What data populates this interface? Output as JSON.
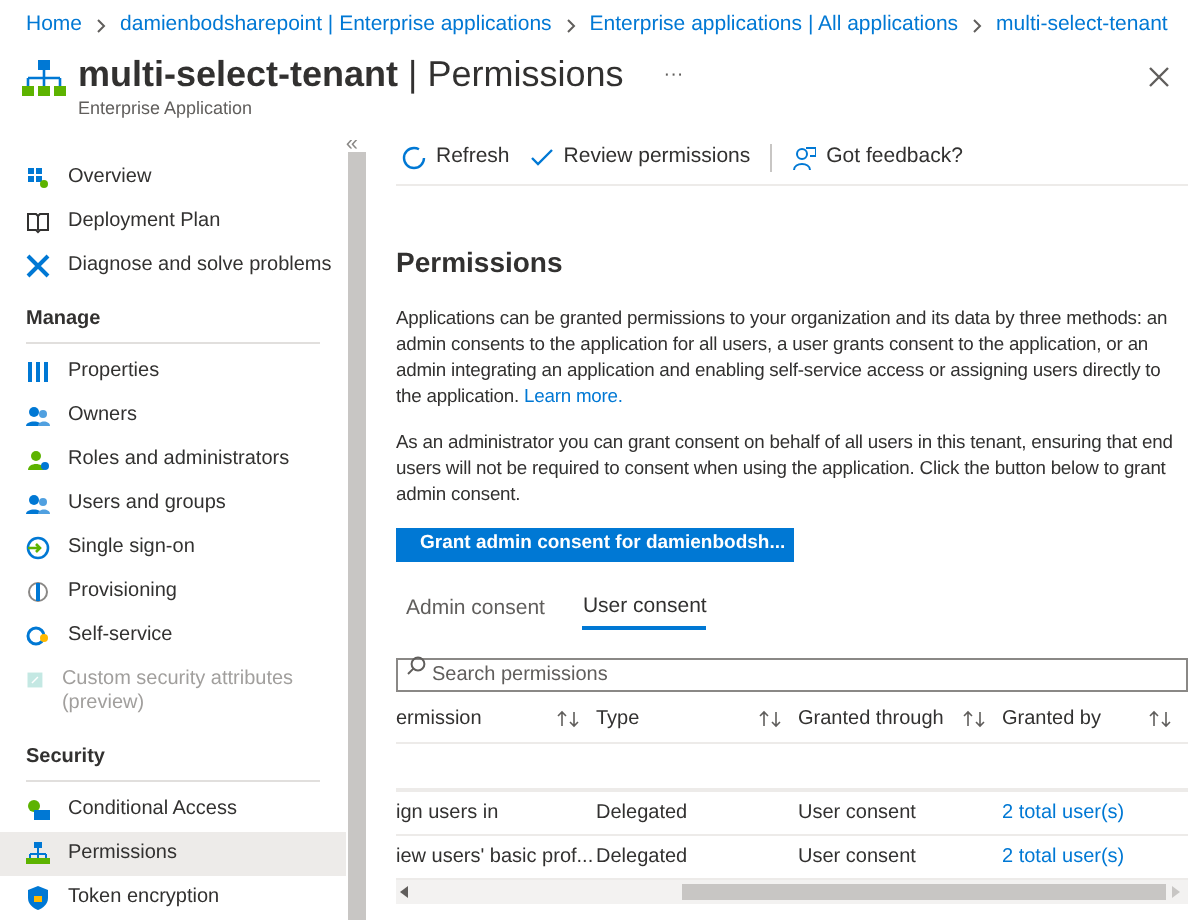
{
  "breadcrumb": [
    "Home",
    "damienbodsharepoint | Enterprise applications",
    "Enterprise applications | All applications",
    "multi-select-tenant"
  ],
  "header": {
    "title": "multi-select-tenant",
    "separator": "|",
    "page": "Permissions",
    "subtitle": "Enterprise Application",
    "more": "···"
  },
  "sidebar": {
    "collapse": "«",
    "sections": [
      {
        "items": [
          {
            "label": "Overview",
            "selected": false,
            "disabled": false
          },
          {
            "label": "Deployment Plan",
            "selected": false,
            "disabled": false
          },
          {
            "label": "Diagnose and solve problems",
            "selected": false,
            "disabled": false
          }
        ]
      },
      {
        "heading": "Manage",
        "items": [
          {
            "label": "Properties",
            "selected": false,
            "disabled": false
          },
          {
            "label": "Owners",
            "selected": false,
            "disabled": false
          },
          {
            "label": "Roles and administrators",
            "selected": false,
            "disabled": false
          },
          {
            "label": "Users and groups",
            "selected": false,
            "disabled": false
          },
          {
            "label": "Single sign-on",
            "selected": false,
            "disabled": false
          },
          {
            "label": "Provisioning",
            "selected": false,
            "disabled": false
          },
          {
            "label": "Self-service",
            "selected": false,
            "disabled": false
          },
          {
            "label": "Custom security attributes (preview)",
            "selected": false,
            "disabled": true
          }
        ]
      },
      {
        "heading": "Security",
        "items": [
          {
            "label": "Conditional Access",
            "selected": false,
            "disabled": false
          },
          {
            "label": "Permissions",
            "selected": true,
            "disabled": false
          },
          {
            "label": "Token encryption",
            "selected": false,
            "disabled": false
          }
        ]
      }
    ]
  },
  "toolbar": [
    "Refresh",
    "Review permissions",
    "Got feedback?"
  ],
  "content": {
    "heading": "Permissions",
    "intro": "Applications can be granted permissions to your organization and its data by three methods: an admin consents to the application for all users, a user grants consent to the application, or an admin integrating an application and enabling self-service access or assigning users directly to the application.",
    "learn_more": "Learn more.",
    "note": "As an administrator you can grant consent on behalf of all users in this tenant, ensuring that end users will not be required to consent when using the application. Click the button below to grant admin consent.",
    "grant_button": "Grant admin consent for damienbodsh...",
    "tabs": [
      {
        "label": "Admin consent",
        "selected": false
      },
      {
        "label": "User consent",
        "selected": true
      }
    ],
    "search": {
      "placeholder": "Search permissions"
    },
    "table": {
      "columns": [
        "ermission",
        "Type",
        "Granted through",
        "Granted by"
      ],
      "rows": [
        [
          "ign users in",
          "Delegated",
          "User consent",
          "2 total user(s)"
        ],
        [
          "iew users' basic prof...",
          "Delegated",
          "User consent",
          "2 total user(s)"
        ]
      ]
    }
  }
}
